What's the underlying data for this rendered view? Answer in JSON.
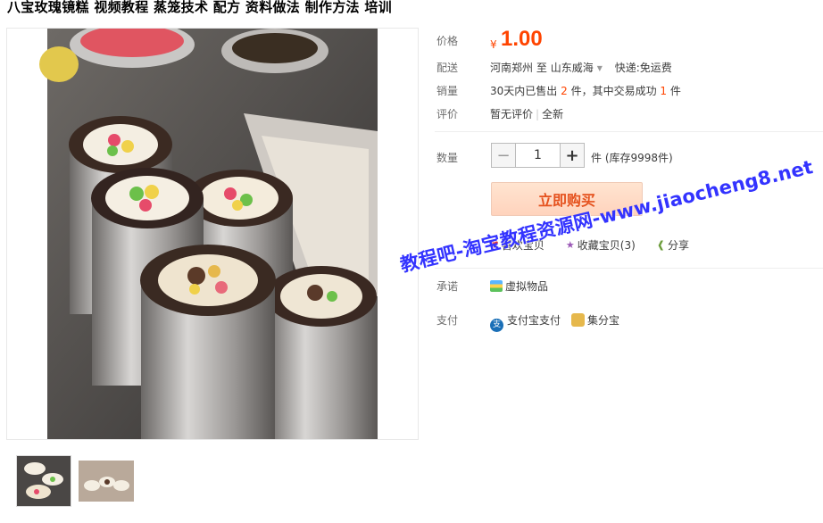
{
  "product": {
    "title": "八宝玫瑰镜糕 视频教程 蒸笼技术 配方 资料做法 制作方法 培训"
  },
  "price": {
    "label": "价格",
    "currency_symbol": "¥",
    "value": "1.00"
  },
  "shipping": {
    "label": "配送",
    "from": "河南郑州",
    "to_word": "至",
    "destination": "山东威海",
    "express_label": "快递:",
    "express_value": "免运费"
  },
  "sales": {
    "label": "销量",
    "prefix": "30天内已售出",
    "sold_count": "2",
    "middle": "件，其中交易成功",
    "success_count": "1",
    "suffix": "件"
  },
  "rating": {
    "label": "评价",
    "value": "暂无评价",
    "condition": "全新"
  },
  "quantity": {
    "label": "数量",
    "minus": "−",
    "value": "1",
    "plus": "+",
    "stock_text": "件 (库存9998件)"
  },
  "buy_button": {
    "label": "立即购买"
  },
  "social": {
    "like_label": "喜欢宝贝",
    "favorite_label": "收藏宝贝(3)",
    "share_label": "分享"
  },
  "promise": {
    "label": "承诺",
    "value": "虚拟物品"
  },
  "payment": {
    "label": "支付",
    "alipay": "支付宝支付",
    "jifen": "集分宝"
  },
  "watermark": {
    "text": "教程吧-淘宝教程资源网-www.jiaocheng8.net"
  },
  "colors": {
    "price": "#ff4400",
    "watermark": "#3333ff",
    "buy_button_text": "#e5511d"
  }
}
